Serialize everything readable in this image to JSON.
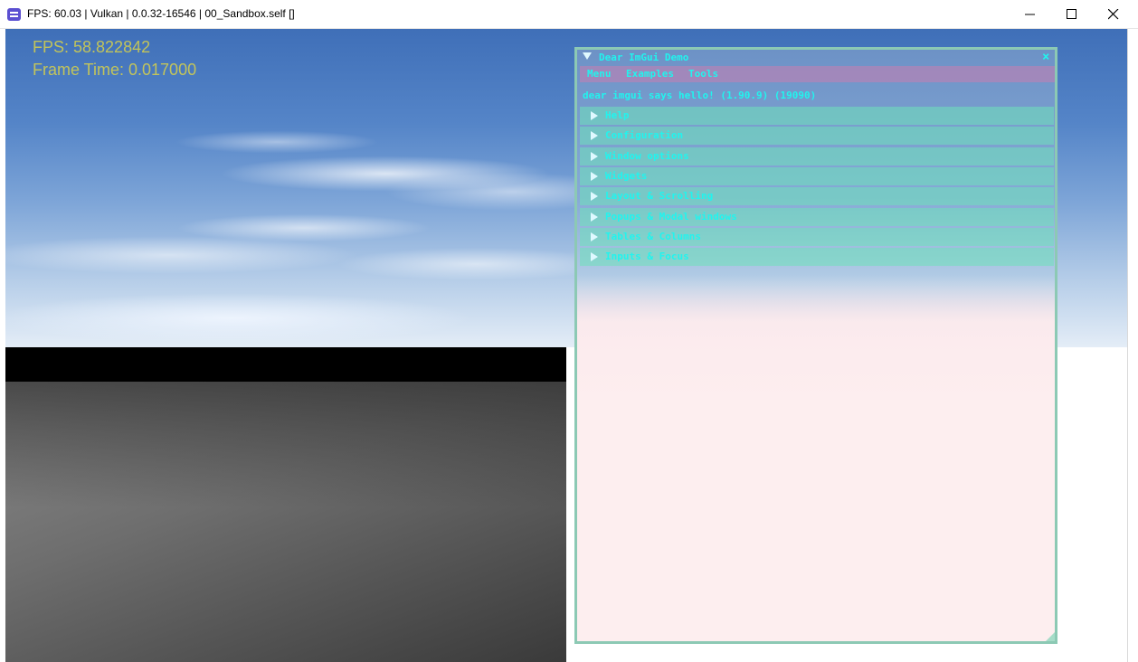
{
  "window": {
    "title": "FPS: 60.03 | Vulkan | 0.0.32-16546 | 00_Sandbox.self []"
  },
  "overlay": {
    "fps": "FPS: 58.822842",
    "frame_time": "Frame Time: 0.017000"
  },
  "imgui": {
    "title": "Dear ImGui Demo",
    "close_glyph": "×",
    "menu": [
      "Menu",
      "Examples",
      "Tools"
    ],
    "hello": "dear imgui says hello! (1.90.9) (19090)",
    "headers": [
      "Help",
      "Configuration",
      "Window options",
      "Widgets",
      "Layout & Scrolling",
      "Popups & Modal windows",
      "Tables & Columns",
      "Inputs & Focus"
    ]
  },
  "colors": {
    "imgui_text": "#21f4ee",
    "overlay_text": "#d8d24a",
    "imgui_border": "#8cc9b4"
  }
}
